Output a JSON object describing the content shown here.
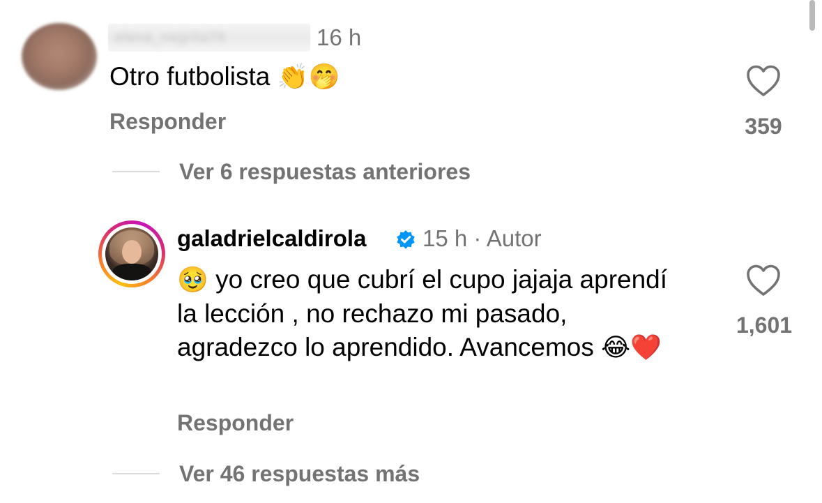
{
  "comments": [
    {
      "username": "elena_negrita79",
      "time": "16 h",
      "text": "Otro futbolista",
      "emojis": "👏🤭",
      "reply_label": "Responder",
      "likes": "359"
    },
    {
      "username": "galadrielcaldirola",
      "verified": true,
      "time": "15 h",
      "separator": "·",
      "author_tag": "Autor",
      "lead_emoji": "🥹",
      "text": "yo creo que cubrí el cupo jajaja aprendí la lección , no rechazo mi pasado, agradezco lo aprendido. Avancemos",
      "trail_emojis": "😂❤️",
      "reply_label": "Responder",
      "likes": "1,601"
    }
  ],
  "threads": {
    "previous": "Ver 6 respuestas anteriores",
    "more": "Ver 46 respuestas más"
  },
  "icons": {
    "like": "heart-outline-icon",
    "verified": "verified-badge-icon"
  },
  "colors": {
    "secondary_text": "#737373",
    "verified_blue": "#0095f6",
    "divider": "#dbdbdb"
  }
}
